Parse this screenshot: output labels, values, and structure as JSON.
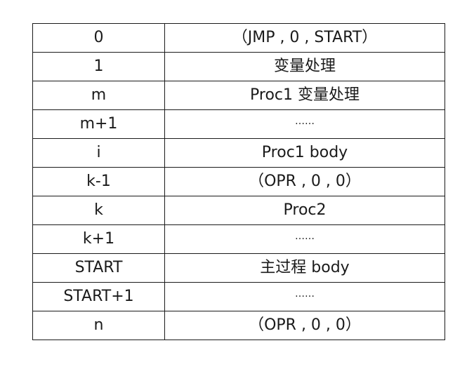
{
  "rows": [
    {
      "address": "0",
      "content": "（JMP , 0 , START）"
    },
    {
      "address": "1",
      "content": "变量处理"
    },
    {
      "address": "m",
      "content": "Proc1 变量处理"
    },
    {
      "address": "m+1",
      "content": "……"
    },
    {
      "address": "i",
      "content": "Proc1 body"
    },
    {
      "address": "k-1",
      "content": "（OPR , 0 , 0）"
    },
    {
      "address": "k",
      "content": "Proc2"
    },
    {
      "address": "k+1",
      "content": "……"
    },
    {
      "address": "START",
      "content": "主过程 body"
    },
    {
      "address": "START+1",
      "content": "……"
    },
    {
      "address": "n",
      "content": "（OPR , 0 , 0）"
    }
  ]
}
